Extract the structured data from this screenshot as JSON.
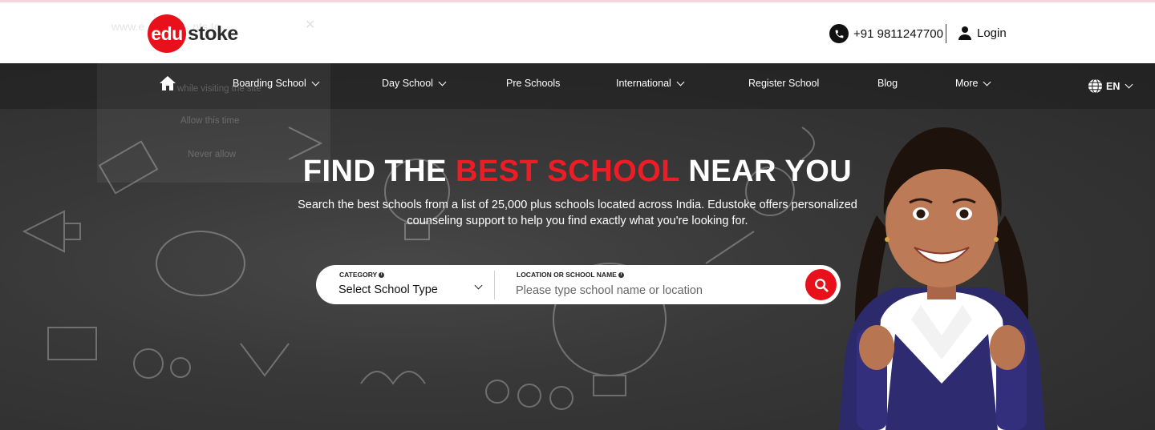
{
  "header": {
    "logo_part1": "edu",
    "logo_part2": "stoke",
    "ghost_url": "www.e",
    "ghost_wants": "nts to",
    "phone": "+91 9811247700",
    "login": "Login"
  },
  "nav": {
    "items": [
      {
        "label": "Boarding School",
        "has_dropdown": true
      },
      {
        "label": "Day School",
        "has_dropdown": true
      },
      {
        "label": "Pre Schools",
        "has_dropdown": false
      },
      {
        "label": "International",
        "has_dropdown": true
      },
      {
        "label": "Register School",
        "has_dropdown": false
      },
      {
        "label": "Blog",
        "has_dropdown": false
      },
      {
        "label": "More",
        "has_dropdown": true
      }
    ],
    "language": "EN"
  },
  "ghost_popup": {
    "line1": "while visiting the site",
    "line2": "Allow this time",
    "line3": "Never allow"
  },
  "hero": {
    "title_part1": "FIND THE ",
    "title_highlight": "BEST SCHOOL",
    "title_part2": " NEAR YOU",
    "subtitle": "Search the best schools from a list of 25,000 plus schools located across India. Edustoke offers personalized counseling support to help you find exactly what you're looking for."
  },
  "search": {
    "category_label": "CATEGORY",
    "category_value": "Select School Type",
    "location_label": "LOCATION OR SCHOOL NAME",
    "location_placeholder": "Please type school name or location",
    "location_value": ""
  },
  "colors": {
    "brand_red": "#e8101b",
    "hero_dark": "#383838",
    "uniform_navy": "#2c2a6b"
  }
}
